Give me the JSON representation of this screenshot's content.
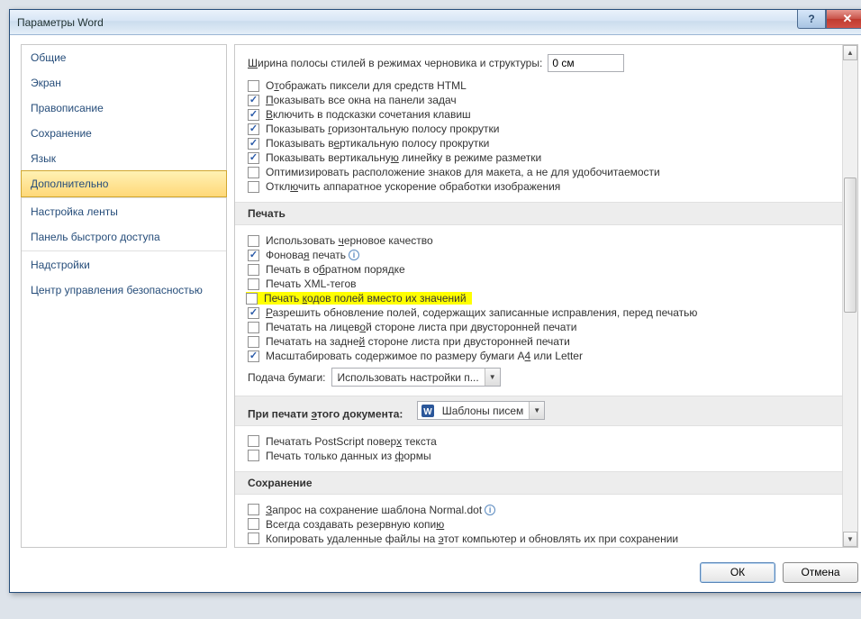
{
  "window": {
    "title": "Параметры Word"
  },
  "sidebar": {
    "items": [
      "Общие",
      "Экран",
      "Правописание",
      "Сохранение",
      "Язык",
      "Дополнительно",
      "Настройка ленты",
      "Панель быстрого доступа",
      "Надстройки",
      "Центр управления безопасностью"
    ],
    "selected_index": 5
  },
  "display": {
    "style_width_label": "Ширина полосы стилей в режимах черновика и структуры:",
    "style_width_value": "0 см",
    "options": [
      {
        "label_pre": "О",
        "u": "т",
        "label_post": "ображать пиксели для средств HTML",
        "checked": false
      },
      {
        "label_pre": "",
        "u": "П",
        "label_post": "оказывать все окна на панели задач",
        "checked": true
      },
      {
        "label_pre": "",
        "u": "В",
        "label_post": "ключить в подсказки сочетания клавиш",
        "checked": true
      },
      {
        "label_pre": "Показывать ",
        "u": "г",
        "label_post": "оризонтальную полосу прокрутки",
        "checked": true
      },
      {
        "label_pre": "Показывать в",
        "u": "е",
        "label_post": "ртикальную полосу прокрутки",
        "checked": true
      },
      {
        "label_pre": "Показывать вертикальну",
        "u": "ю",
        "label_post": " линейку в режиме разметки",
        "checked": true
      },
      {
        "label_pre": "Оптимизировать расположение знаков для макета, а не для удобочитаемости",
        "u": "",
        "label_post": "",
        "checked": false
      },
      {
        "label_pre": "Откл",
        "u": "ю",
        "label_post": "чить аппаратное ускорение обработки изображения",
        "checked": false
      }
    ]
  },
  "print": {
    "header": "Печать",
    "options": [
      {
        "label_pre": "Использовать ",
        "u": "ч",
        "label_post": "ерновое качество",
        "checked": false,
        "info": false
      },
      {
        "label_pre": "Фонова",
        "u": "я",
        "label_post": " печать",
        "checked": true,
        "info": true
      },
      {
        "label_pre": "Печать в о",
        "u": "б",
        "label_post": "ратном порядке",
        "checked": false,
        "info": false
      },
      {
        "label_pre": "Печать XML-тегов",
        "u": "",
        "label_post": "",
        "checked": false,
        "info": false
      },
      {
        "label_pre": "Печать ",
        "u": "к",
        "label_post": "одов полей вместо их значений",
        "checked": false,
        "info": false,
        "highlight": true
      },
      {
        "label_pre": "",
        "u": "Р",
        "label_post": "азрешить обновление полей, содержащих записанные исправления, перед печатью",
        "checked": true,
        "info": false
      },
      {
        "label_pre": "Печатать на лицев",
        "u": "о",
        "label_post": "й стороне листа при двусторонней печати",
        "checked": false,
        "info": false
      },
      {
        "label_pre": "Печатать на задне",
        "u": "й",
        "label_post": " стороне листа при двусторонней печати",
        "checked": false,
        "info": false
      },
      {
        "label_pre": "Масштабировать содержимое по размеру бумаги A",
        "u": "4",
        "label_post": " или Letter",
        "checked": true,
        "info": false
      }
    ],
    "tray_label": "Подача бумаги:",
    "tray_value": "Использовать настройки п..."
  },
  "print_doc": {
    "header_pre": "При печати ",
    "header_u": "э",
    "header_post": "того документа:",
    "doc_value": "Шаблоны писем",
    "options": [
      {
        "label_pre": "Печатать PostScript повер",
        "u": "х",
        "label_post": " текста",
        "checked": false
      },
      {
        "label_pre": "Печать только данных из ",
        "u": "ф",
        "label_post": "ормы",
        "checked": false
      }
    ]
  },
  "save": {
    "header": "Сохранение",
    "options": [
      {
        "label_pre": "",
        "u": "З",
        "label_post": "апрос на сохранение шаблона Normal.dot",
        "checked": false,
        "info": true
      },
      {
        "label_pre": "Всегда создавать резервную копи",
        "u": "ю",
        "label_post": "",
        "checked": false,
        "info": false
      },
      {
        "label_pre": "Копировать удаленные файлы на ",
        "u": "э",
        "label_post": "тот компьютер и обновлять их при сохранении",
        "checked": false,
        "info": false
      }
    ]
  },
  "footer": {
    "ok": "ОК",
    "cancel": "Отмена"
  }
}
